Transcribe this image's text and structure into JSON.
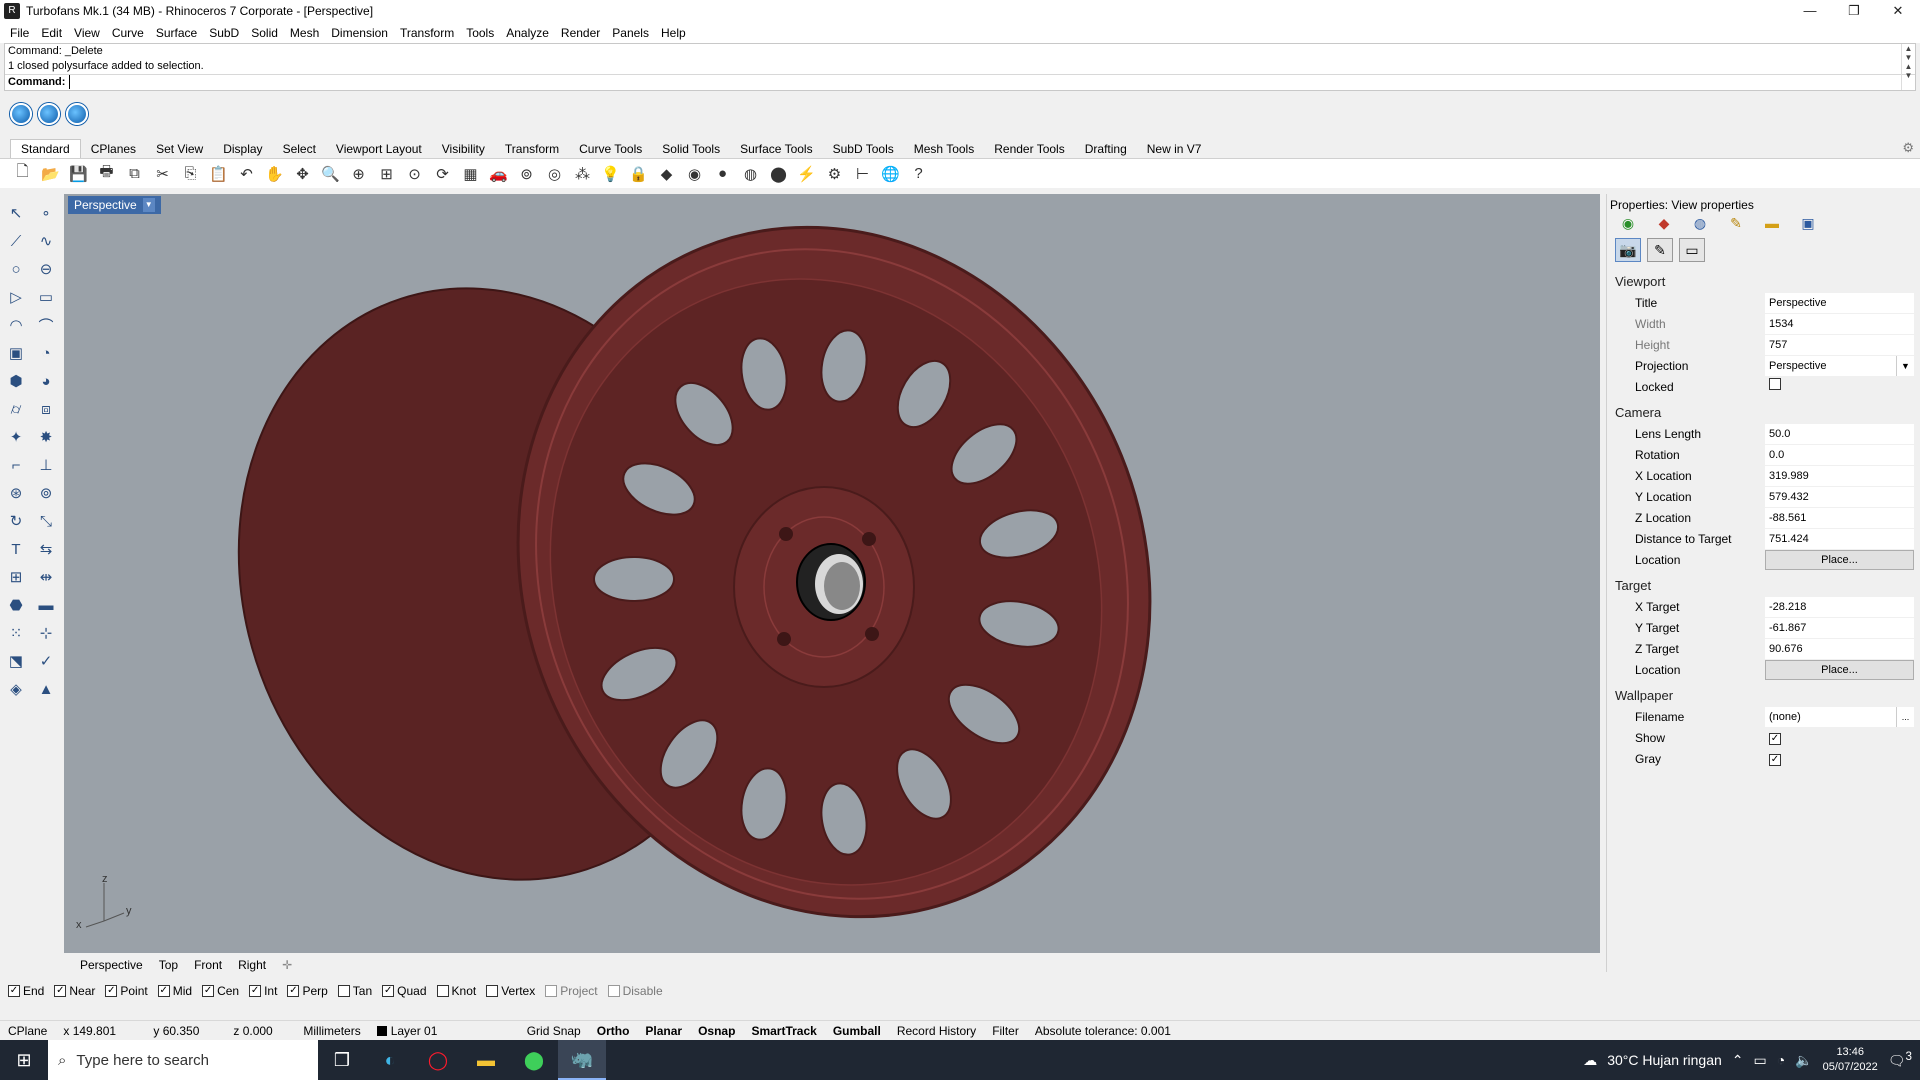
{
  "window": {
    "title": "Turbofans Mk.1 (34 MB) - Rhinoceros 7 Corporate - [Perspective]",
    "minimize": "—",
    "maximize": "❐",
    "close": "✕"
  },
  "menu": [
    "File",
    "Edit",
    "View",
    "Curve",
    "Surface",
    "SubD",
    "Solid",
    "Mesh",
    "Dimension",
    "Transform",
    "Tools",
    "Analyze",
    "Render",
    "Panels",
    "Help"
  ],
  "command": {
    "history_1": "Command: _Delete",
    "history_2": "1 closed polysurface added to selection.",
    "prompt_label": "Command:",
    "input_value": ""
  },
  "toolbar_tabs": [
    "Standard",
    "CPlanes",
    "Set View",
    "Display",
    "Select",
    "Viewport Layout",
    "Visibility",
    "Transform",
    "Curve Tools",
    "Solid Tools",
    "Surface Tools",
    "SubD Tools",
    "Mesh Tools",
    "Render Tools",
    "Drafting",
    "New in V7"
  ],
  "viewport": {
    "label": "Perspective",
    "axis_x": "x",
    "axis_y": "y",
    "axis_z": "z",
    "wheel_color": "#6b2a2a"
  },
  "viewport_tabs": [
    "Perspective",
    "Top",
    "Front",
    "Right"
  ],
  "osnaps": [
    {
      "label": "End",
      "checked": true
    },
    {
      "label": "Near",
      "checked": true
    },
    {
      "label": "Point",
      "checked": true
    },
    {
      "label": "Mid",
      "checked": true
    },
    {
      "label": "Cen",
      "checked": true
    },
    {
      "label": "Int",
      "checked": true
    },
    {
      "label": "Perp",
      "checked": true
    },
    {
      "label": "Tan",
      "checked": false
    },
    {
      "label": "Quad",
      "checked": true
    },
    {
      "label": "Knot",
      "checked": false
    },
    {
      "label": "Vertex",
      "checked": false
    },
    {
      "label": "Project",
      "checked": false,
      "dim": true
    },
    {
      "label": "Disable",
      "checked": false,
      "dim": true
    }
  ],
  "status": {
    "cplane": "CPlane",
    "x": "x 149.801",
    "y": "y 60.350",
    "z": "z 0.000",
    "units": "Millimeters",
    "layer": "Layer 01",
    "grid_snap": "Grid Snap",
    "ortho": "Ortho",
    "planar": "Planar",
    "osnap": "Osnap",
    "smarttrack": "SmartTrack",
    "gumball": "Gumball",
    "record_history": "Record History",
    "filter": "Filter",
    "tolerance": "Absolute tolerance: 0.001"
  },
  "properties": {
    "title": "Properties: View properties",
    "sections": {
      "viewport": "Viewport",
      "camera": "Camera",
      "target": "Target",
      "wallpaper": "Wallpaper"
    },
    "viewport": {
      "title_label": "Title",
      "title_value": "Perspective",
      "width_label": "Width",
      "width_value": "1534",
      "height_label": "Height",
      "height_value": "757",
      "projection_label": "Projection",
      "projection_value": "Perspective",
      "locked_label": "Locked"
    },
    "camera": {
      "lens_label": "Lens Length",
      "lens_value": "50.0",
      "rotation_label": "Rotation",
      "rotation_value": "0.0",
      "xloc_label": "X Location",
      "xloc_value": "319.989",
      "yloc_label": "Y Location",
      "yloc_value": "579.432",
      "zloc_label": "Z Location",
      "zloc_value": "-88.561",
      "dist_label": "Distance to Target",
      "dist_value": "751.424",
      "location_label": "Location",
      "place_button": "Place..."
    },
    "target": {
      "xt_label": "X Target",
      "xt_value": "-28.218",
      "yt_label": "Y Target",
      "yt_value": "-61.867",
      "zt_label": "Z Target",
      "zt_value": "90.676",
      "location_label": "Location",
      "place_button": "Place..."
    },
    "wallpaper": {
      "filename_label": "Filename",
      "filename_value": "(none)",
      "browse": "...",
      "show_label": "Show",
      "gray_label": "Gray"
    }
  },
  "taskbar": {
    "search_placeholder": "Type here to search",
    "weather": "30°C  Hujan ringan",
    "time": "13:46",
    "date": "05/07/2022",
    "notifications": "3"
  }
}
